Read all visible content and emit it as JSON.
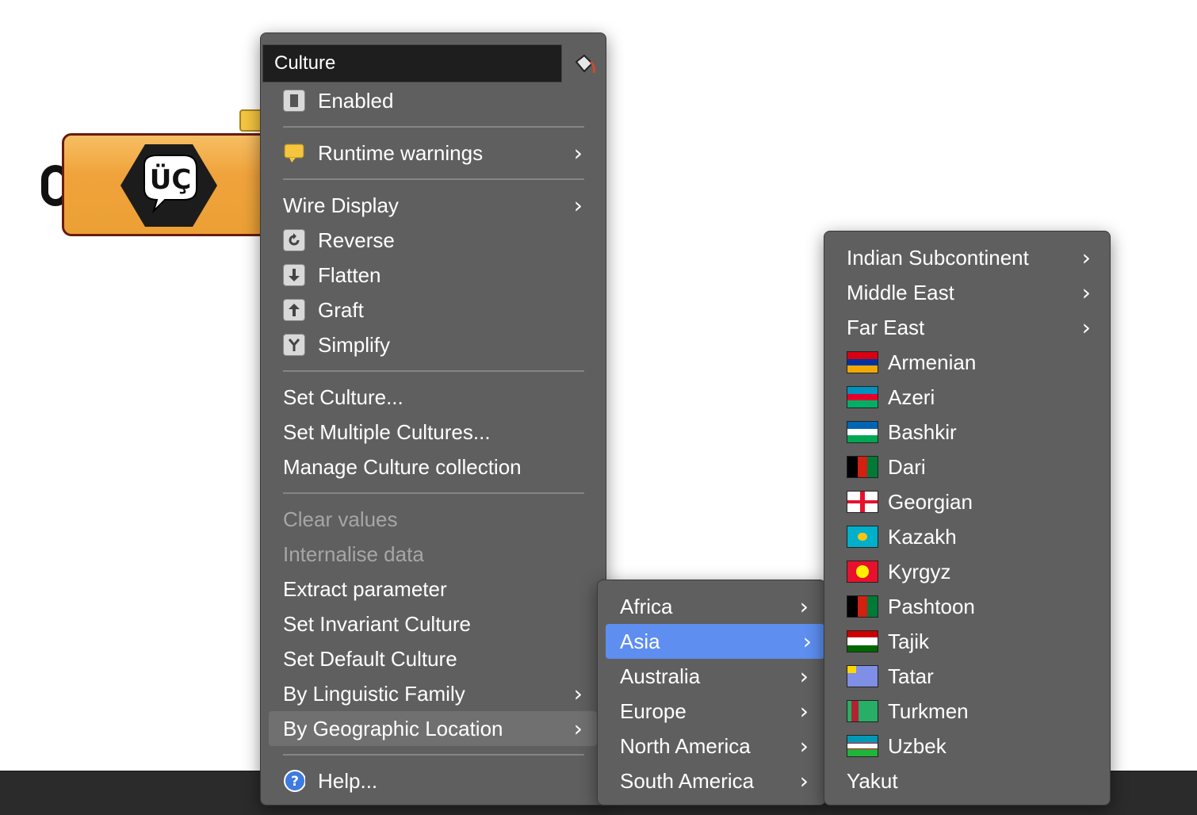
{
  "component": {
    "icon_text": "ÜÇ"
  },
  "main_menu": {
    "title": "Culture",
    "items": {
      "enabled": "Enabled",
      "runtime_warnings": "Runtime warnings",
      "wire_display": "Wire Display",
      "reverse": "Reverse",
      "flatten": "Flatten",
      "graft": "Graft",
      "simplify": "Simplify",
      "set_culture": "Set Culture...",
      "set_multiple": "Set Multiple Cultures...",
      "manage": "Manage Culture collection",
      "clear_values": "Clear values",
      "internalise": "Internalise data",
      "extract": "Extract parameter",
      "invariant": "Set Invariant Culture",
      "default": "Set Default Culture",
      "linguistic": "By Linguistic Family",
      "geographic": "By Geographic Location",
      "help": "Help..."
    }
  },
  "region_menu": {
    "items": [
      "Africa",
      "Asia",
      "Australia",
      "Europe",
      "North America",
      "South America"
    ],
    "selected": "Asia"
  },
  "asia_menu": {
    "subregions": [
      "Indian Subcontinent",
      "Middle East",
      "Far East"
    ],
    "cultures": [
      "Armenian",
      "Azeri",
      "Bashkir",
      "Dari",
      "Georgian",
      "Kazakh",
      "Kyrgyz",
      "Pashtoon",
      "Tajik",
      "Tatar",
      "Turkmen",
      "Uzbek",
      "Yakut"
    ]
  },
  "colors": {
    "selection": "#5d8ef0",
    "menu_bg": "#5f5f5f",
    "component": "#f0a33b"
  }
}
